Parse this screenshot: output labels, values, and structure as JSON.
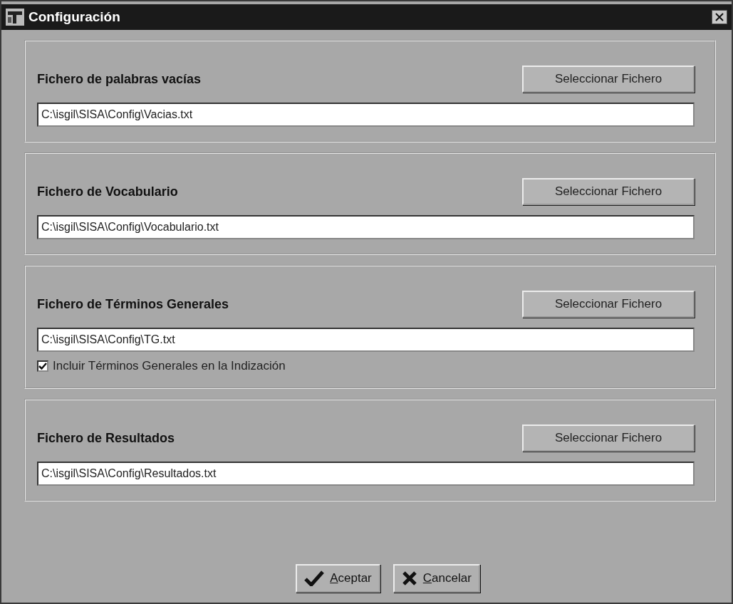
{
  "window": {
    "title": "Configuración"
  },
  "groups": [
    {
      "label": "Fichero de palabras vacías",
      "button": "Seleccionar Fichero",
      "path": "C:\\isgil\\SISA\\Config\\Vacias.txt"
    },
    {
      "label": "Fichero de Vocabulario",
      "button": "Seleccionar Fichero",
      "path": "C:\\isgil\\SISA\\Config\\Vocabulario.txt"
    },
    {
      "label": "Fichero de Términos Generales",
      "button": "Seleccionar Fichero",
      "path": "C:\\isgil\\SISA\\Config\\TG.txt",
      "checkbox": {
        "label": "Incluir Términos Generales en la Indización",
        "checked": true
      }
    },
    {
      "label": "Fichero de Resultados",
      "button": "Seleccionar Fichero",
      "path": "C:\\isgil\\SISA\\Config\\Resultados.txt"
    }
  ],
  "buttons": [
    {
      "label": "Aceptar",
      "kind": "accept"
    },
    {
      "label": "Cancelar",
      "kind": "cancel"
    }
  ]
}
